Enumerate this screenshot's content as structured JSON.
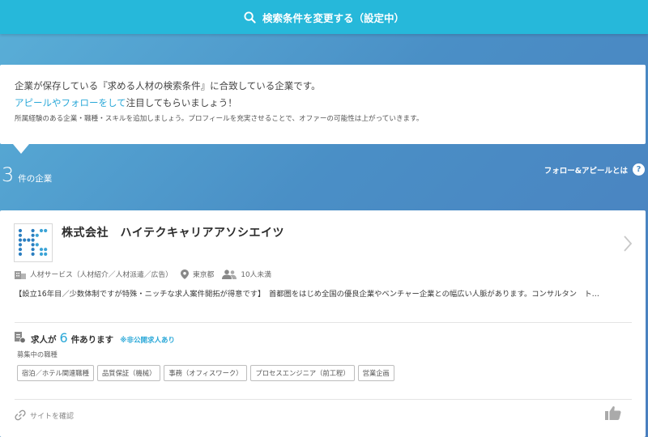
{
  "search_bar": {
    "label": "検索条件を変更する（設定中）",
    "icon": "search-icon",
    "bg_color": "#26b8da"
  },
  "info": {
    "line1": "企業が保存している『求める人材の検索条件』に合致している企業です。",
    "line2_link": "アピールやフォローをして",
    "line2_rest": "注目してもらいましょう！",
    "line3": "所属経験のある企業・職種・スキルを追加しましょう。プロフィールを充実させることで、オファーの可能性は上がっていきます。",
    "link_color": "#2aa8d8"
  },
  "results": {
    "count": "3",
    "unit": "件の企業",
    "help_label": "フォロー&アピールとは",
    "help_icon_text": "?"
  },
  "company": {
    "name": "株式会社　ハイテクキャリアアソシエイツ",
    "industry": "人材サービス（人材紹介／人材派遣／広告）",
    "location": "東京都",
    "size": "10人未満",
    "description": "【設立16年目／少数体制ですが特殊・ニッチな求人案件開拓が得意です】　首都圏をはじめ全国の優良企業やベンチャー企業との幅広い人脈があります。コンサルタン　ト…",
    "jobs_prefix": "求人が",
    "jobs_count": "6",
    "jobs_suffix": "件あります",
    "jobs_private": "※非公開求人あり",
    "recruiting_label": "募集中の職種",
    "tags": [
      "宿泊／ホテル関連職種",
      "品質保証（機械）",
      "事務（オフィスワーク）",
      "プロセスエンジニア（前工程）",
      "営業企画"
    ],
    "site_link": "サイトを確認"
  }
}
